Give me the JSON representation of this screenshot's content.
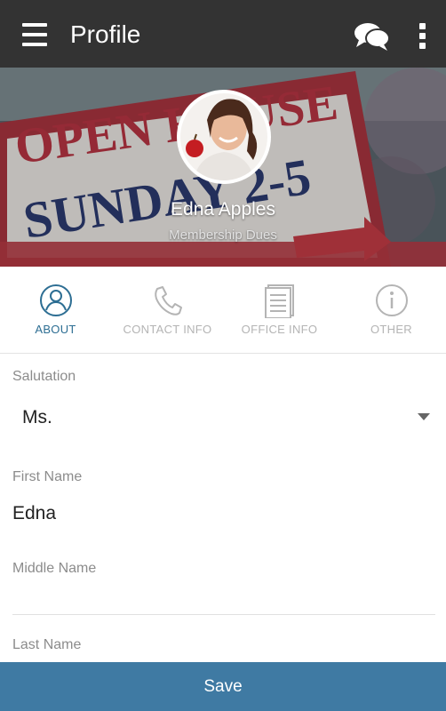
{
  "appbar": {
    "title": "Profile",
    "menu_icon": "hamburger-menu-icon",
    "chat_icon": "chat-bubbles-icon",
    "more_icon": "more-vertical-icon"
  },
  "profile": {
    "name": "Edna Apples",
    "subtitle": "Membership Dues",
    "banner_text": [
      "OPEN HOUSE",
      "SUNDAY 2-5"
    ]
  },
  "tabs": [
    {
      "label": "ABOUT",
      "icon": "person-icon",
      "active": true
    },
    {
      "label": "CONTACT INFO",
      "icon": "phone-icon",
      "active": false
    },
    {
      "label": "OFFICE INFO",
      "icon": "document-icon",
      "active": false
    },
    {
      "label": "OTHER",
      "icon": "info-icon",
      "active": false
    }
  ],
  "form": {
    "salutation": {
      "label": "Salutation",
      "value": "Ms."
    },
    "first_name": {
      "label": "First Name",
      "value": "Edna"
    },
    "middle_name": {
      "label": "Middle Name",
      "value": ""
    },
    "last_name": {
      "label": "Last Name",
      "value": ""
    }
  },
  "save_label": "Save",
  "colors": {
    "appbar": "#333333",
    "accent": "#2d6e93",
    "save_button": "#3f7aa3",
    "inactive_tab": "#b4b4b4"
  }
}
